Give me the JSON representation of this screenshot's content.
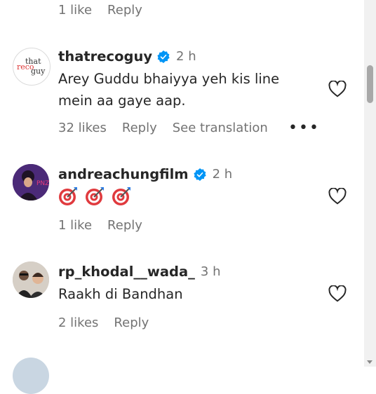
{
  "top_meta": {
    "likes": "1 like",
    "reply": "Reply"
  },
  "comments": [
    {
      "username": "thatrecoguy",
      "avatar_text": [
        "that",
        "reco",
        "guy"
      ],
      "time": "2 h",
      "text": "Arey Guddu bhaiyya yeh kis line mein aa gaye aap.",
      "likes": "32 likes",
      "reply": "Reply",
      "translate": "See translation",
      "more": "•••"
    },
    {
      "username": "andreachungfilm",
      "time": "2 h",
      "emoji_count": 3,
      "emoji_icon": "direct-hit-icon",
      "likes": "1 like",
      "reply": "Reply"
    },
    {
      "username": "rp_khodal__wada_",
      "time": "3 h",
      "text": "Raakh di Bandhan",
      "likes": "2 likes",
      "reply": "Reply"
    }
  ],
  "colors": {
    "verified": "#0095f6",
    "muted": "#737373",
    "text": "#262626"
  }
}
